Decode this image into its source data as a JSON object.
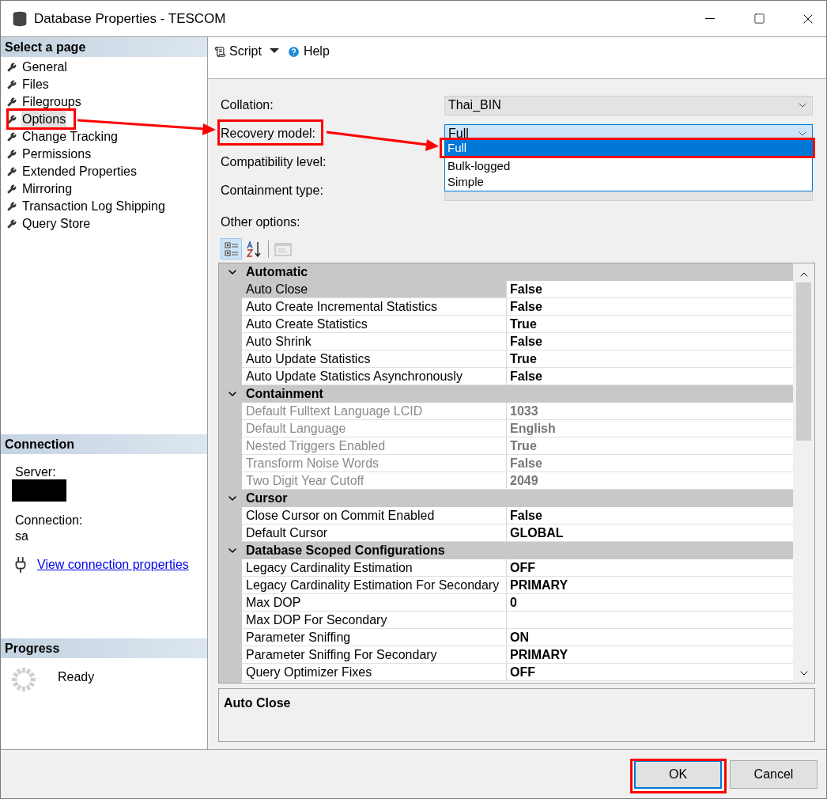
{
  "window": {
    "title": "Database Properties - TESCOM"
  },
  "sidebar": {
    "header": "Select a page",
    "items": [
      {
        "label": "General",
        "selected": false
      },
      {
        "label": "Files",
        "selected": false
      },
      {
        "label": "Filegroups",
        "selected": false
      },
      {
        "label": "Options",
        "selected": true
      },
      {
        "label": "Change Tracking",
        "selected": false
      },
      {
        "label": "Permissions",
        "selected": false
      },
      {
        "label": "Extended Properties",
        "selected": false
      },
      {
        "label": "Mirroring",
        "selected": false
      },
      {
        "label": "Transaction Log Shipping",
        "selected": false
      },
      {
        "label": "Query Store",
        "selected": false
      }
    ]
  },
  "connection": {
    "header": "Connection",
    "server_label": "Server:",
    "connection_label": "Connection:",
    "connection_value": "sa",
    "link": "View connection properties"
  },
  "progress": {
    "header": "Progress",
    "status": "Ready"
  },
  "toolbar": {
    "script": "Script",
    "help": "Help"
  },
  "fields": [
    {
      "label": "Collation:",
      "kind": "readonly",
      "value": "Thai_BIN"
    },
    {
      "label": "Recovery model:",
      "kind": "open",
      "value": "Full"
    },
    {
      "label": "Compatibility level:",
      "kind": "covered"
    },
    {
      "label": "Containment type:",
      "kind": "covered"
    }
  ],
  "dropdown": {
    "options": [
      {
        "label": "Full",
        "selected": true
      },
      {
        "label": "Bulk-logged",
        "selected": false
      },
      {
        "label": "Simple",
        "selected": false
      }
    ]
  },
  "other_options": {
    "label": "Other options:"
  },
  "grid_toolbar": {
    "categorized": {
      "selected": true
    },
    "alphabetical": {
      "selected": false
    }
  },
  "grid": {
    "categories": [
      {
        "name": "Automatic",
        "expanded": true,
        "rows": [
          {
            "name": "Auto Close",
            "value": "False",
            "disabled": false,
            "selected": true
          },
          {
            "name": "Auto Create Incremental Statistics",
            "value": "False",
            "disabled": false,
            "selected": false
          },
          {
            "name": "Auto Create Statistics",
            "value": "True",
            "disabled": false,
            "selected": false
          },
          {
            "name": "Auto Shrink",
            "value": "False",
            "disabled": false,
            "selected": false
          },
          {
            "name": "Auto Update Statistics",
            "value": "True",
            "disabled": false,
            "selected": false
          },
          {
            "name": "Auto Update Statistics Asynchronously",
            "value": "False",
            "disabled": false,
            "selected": false
          }
        ]
      },
      {
        "name": "Containment",
        "expanded": true,
        "rows": [
          {
            "name": "Default Fulltext Language LCID",
            "value": "1033",
            "disabled": true,
            "selected": false
          },
          {
            "name": "Default Language",
            "value": "English",
            "disabled": true,
            "selected": false
          },
          {
            "name": "Nested Triggers Enabled",
            "value": "True",
            "disabled": true,
            "selected": false
          },
          {
            "name": "Transform Noise Words",
            "value": "False",
            "disabled": true,
            "selected": false
          },
          {
            "name": "Two Digit Year Cutoff",
            "value": "2049",
            "disabled": true,
            "selected": false
          }
        ]
      },
      {
        "name": "Cursor",
        "expanded": true,
        "rows": [
          {
            "name": "Close Cursor on Commit Enabled",
            "value": "False",
            "disabled": false,
            "selected": false
          },
          {
            "name": "Default Cursor",
            "value": "GLOBAL",
            "disabled": false,
            "selected": false
          }
        ]
      },
      {
        "name": "Database Scoped Configurations",
        "expanded": true,
        "rows": [
          {
            "name": "Legacy Cardinality Estimation",
            "value": "OFF",
            "disabled": false,
            "selected": false
          },
          {
            "name": "Legacy Cardinality Estimation For Secondary",
            "value": "PRIMARY",
            "disabled": false,
            "selected": false
          },
          {
            "name": "Max DOP",
            "value": "0",
            "disabled": false,
            "selected": false
          },
          {
            "name": "Max DOP For Secondary",
            "disabled": false,
            "selected": false
          },
          {
            "name": "Parameter Sniffing",
            "value": "ON",
            "disabled": false,
            "selected": false
          },
          {
            "name": "Parameter Sniffing For Secondary",
            "value": "PRIMARY",
            "disabled": false,
            "selected": false
          },
          {
            "name": "Query Optimizer Fixes",
            "value": "OFF",
            "disabled": false,
            "selected": false
          }
        ]
      }
    ]
  },
  "description": {
    "title": "Auto Close"
  },
  "buttons": [
    {
      "label": "OK",
      "default": true
    },
    {
      "label": "Cancel",
      "default": false
    }
  ]
}
